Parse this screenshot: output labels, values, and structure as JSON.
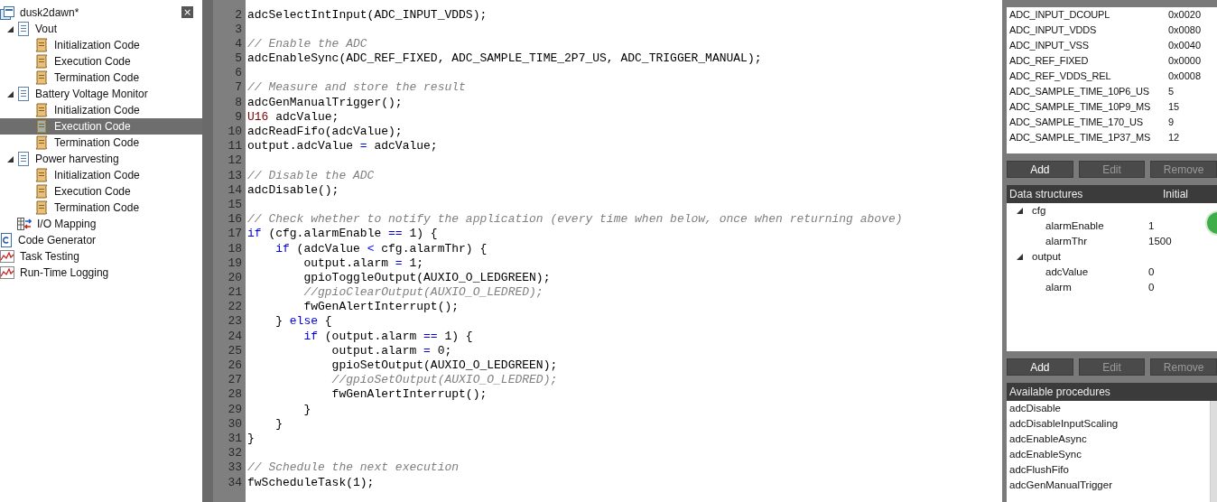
{
  "sidebar": {
    "close_label": "×",
    "items": [
      {
        "label": "dusk2dawn*",
        "kind": "project",
        "children": [
          {
            "label": "Vout",
            "kind": "task",
            "expanded": true,
            "children": [
              {
                "label": "Initialization Code",
                "kind": "code",
                "selected": false
              },
              {
                "label": "Execution Code",
                "kind": "code",
                "selected": false
              },
              {
                "label": "Termination Code",
                "kind": "code",
                "selected": false
              }
            ]
          },
          {
            "label": "Battery Voltage Monitor",
            "kind": "task",
            "expanded": true,
            "children": [
              {
                "label": "Initialization Code",
                "kind": "code",
                "selected": false
              },
              {
                "label": "Execution Code",
                "kind": "code",
                "selected": true
              },
              {
                "label": "Termination Code",
                "kind": "code",
                "selected": false
              }
            ]
          },
          {
            "label": "Power harvesting",
            "kind": "task",
            "expanded": true,
            "children": [
              {
                "label": "Initialization Code",
                "kind": "code",
                "selected": false
              },
              {
                "label": "Execution Code",
                "kind": "code",
                "selected": false
              },
              {
                "label": "Termination Code",
                "kind": "code",
                "selected": false
              }
            ]
          },
          {
            "label": "I/O Mapping",
            "kind": "io"
          }
        ]
      },
      {
        "label": "Code Generator",
        "kind": "codegen"
      },
      {
        "label": "Task Testing",
        "kind": "chart"
      },
      {
        "label": "Run-Time Logging",
        "kind": "chart"
      }
    ]
  },
  "editor": {
    "lines": [
      {
        "num": "2",
        "tokens": [
          {
            "kind": "plain",
            "text": "adcSelectIntInput(ADC_INPUT_VDDS);"
          }
        ]
      },
      {
        "num": "3"
      },
      {
        "num": "4",
        "tokens": [
          {
            "kind": "comment",
            "text": "// Enable the ADC"
          }
        ]
      },
      {
        "num": "5",
        "tokens": [
          {
            "kind": "plain",
            "text": "adcEnableSync(ADC_REF_FIXED, ADC_SAMPLE_TIME_2P7_US, ADC_TRIGGER_MANUAL);"
          }
        ]
      },
      {
        "num": "6"
      },
      {
        "num": "7",
        "tokens": [
          {
            "kind": "comment",
            "text": "// Measure and store the result"
          }
        ]
      },
      {
        "num": "8",
        "tokens": [
          {
            "kind": "plain",
            "text": "adcGenManualTrigger();"
          }
        ]
      },
      {
        "num": "9",
        "tokens": [
          {
            "kind": "type",
            "text": "U16"
          },
          {
            "kind": "plain",
            "text": " adcValue;"
          }
        ]
      },
      {
        "num": "10",
        "tokens": [
          {
            "kind": "plain",
            "text": "adcReadFifo(adcValue);"
          }
        ]
      },
      {
        "num": "11",
        "tokens": [
          {
            "kind": "plain",
            "text": "output.adcValue "
          },
          {
            "kind": "op",
            "text": "="
          },
          {
            "kind": "plain",
            "text": " adcValue;"
          }
        ]
      },
      {
        "num": "12"
      },
      {
        "num": "13",
        "tokens": [
          {
            "kind": "comment",
            "text": "// Disable the ADC"
          }
        ]
      },
      {
        "num": "14",
        "tokens": [
          {
            "kind": "plain",
            "text": "adcDisable();"
          }
        ]
      },
      {
        "num": "15"
      },
      {
        "num": "16",
        "tokens": [
          {
            "kind": "comment",
            "text": "// Check whether to notify the application (every time when below, once when returning above)"
          }
        ]
      },
      {
        "num": "17",
        "tokens": [
          {
            "kind": "keyword",
            "text": "if"
          },
          {
            "kind": "plain",
            "text": " (cfg.alarmEnable "
          },
          {
            "kind": "op",
            "text": "=="
          },
          {
            "kind": "plain",
            "text": " 1) {"
          }
        ]
      },
      {
        "num": "18",
        "tokens": [
          {
            "kind": "keyword",
            "text": "    if"
          },
          {
            "kind": "plain",
            "text": " (adcValue "
          },
          {
            "kind": "op",
            "text": "<"
          },
          {
            "kind": "plain",
            "text": " cfg.alarmThr) {"
          }
        ]
      },
      {
        "num": "19",
        "tokens": [
          {
            "kind": "plain",
            "text": "        output.alarm "
          },
          {
            "kind": "op",
            "text": "="
          },
          {
            "kind": "plain",
            "text": " 1;"
          }
        ]
      },
      {
        "num": "20",
        "tokens": [
          {
            "kind": "plain",
            "text": "        gpioToggleOutput(AUXIO_O_LEDGREEN);"
          }
        ]
      },
      {
        "num": "21",
        "tokens": [
          {
            "kind": "comment",
            "text": "        //gpioClearOutput(AUXIO_O_LEDRED);"
          }
        ]
      },
      {
        "num": "22",
        "tokens": [
          {
            "kind": "plain",
            "text": "        fwGenAlertInterrupt();"
          }
        ]
      },
      {
        "num": "23",
        "tokens": [
          {
            "kind": "plain",
            "text": "    } "
          },
          {
            "kind": "keyword",
            "text": "else"
          },
          {
            "kind": "plain",
            "text": " {"
          }
        ]
      },
      {
        "num": "24",
        "tokens": [
          {
            "kind": "keyword",
            "text": "        if"
          },
          {
            "kind": "plain",
            "text": " (output.alarm "
          },
          {
            "kind": "op",
            "text": "=="
          },
          {
            "kind": "plain",
            "text": " 1) {"
          }
        ]
      },
      {
        "num": "25",
        "tokens": [
          {
            "kind": "plain",
            "text": "            output.alarm "
          },
          {
            "kind": "op",
            "text": "="
          },
          {
            "kind": "plain",
            "text": " 0;"
          }
        ]
      },
      {
        "num": "26",
        "tokens": [
          {
            "kind": "plain",
            "text": "            gpioSetOutput(AUXIO_O_LEDGREEN);"
          }
        ]
      },
      {
        "num": "27",
        "tokens": [
          {
            "kind": "comment",
            "text": "            //gpioSetOutput(AUXIO_O_LEDRED);"
          }
        ]
      },
      {
        "num": "28",
        "tokens": [
          {
            "kind": "plain",
            "text": "            fwGenAlertInterrupt();"
          }
        ]
      },
      {
        "num": "29",
        "tokens": [
          {
            "kind": "plain",
            "text": "        }"
          }
        ]
      },
      {
        "num": "30",
        "tokens": [
          {
            "kind": "plain",
            "text": "    }"
          }
        ]
      },
      {
        "num": "31",
        "tokens": [
          {
            "kind": "plain",
            "text": "}"
          }
        ]
      },
      {
        "num": "32"
      },
      {
        "num": "33",
        "tokens": [
          {
            "kind": "comment",
            "text": "// Schedule the next execution"
          }
        ]
      },
      {
        "num": "34",
        "tokens": [
          {
            "kind": "plain",
            "text": "fwScheduleTask(1);"
          }
        ]
      }
    ]
  },
  "constants": {
    "rows": [
      {
        "name": "ADC_INPUT_DCOUPL",
        "value": "0x0020"
      },
      {
        "name": "ADC_INPUT_VDDS",
        "value": "0x0080"
      },
      {
        "name": "ADC_INPUT_VSS",
        "value": "0x0040"
      },
      {
        "name": "ADC_REF_FIXED",
        "value": "0x0000"
      },
      {
        "name": "ADC_REF_VDDS_REL",
        "value": "0x0008"
      },
      {
        "name": "ADC_SAMPLE_TIME_10P6_US",
        "value": "5"
      },
      {
        "name": "ADC_SAMPLE_TIME_10P9_MS",
        "value": "15"
      },
      {
        "name": "ADC_SAMPLE_TIME_170_US",
        "value": "9"
      },
      {
        "name": "ADC_SAMPLE_TIME_1P37_MS",
        "value": "12"
      }
    ],
    "buttons": [
      {
        "label": "Add",
        "disabled": false
      },
      {
        "label": "Edit",
        "disabled": true
      },
      {
        "label": "Remove",
        "disabled": true
      }
    ]
  },
  "data_structures": {
    "title": "Data structures",
    "column": "Initial",
    "items": [
      {
        "name": "cfg",
        "expanded": true,
        "children": [
          {
            "name": "alarmEnable",
            "value": "1"
          },
          {
            "name": "alarmThr",
            "value": "1500"
          }
        ]
      },
      {
        "name": "output",
        "expanded": true,
        "children": [
          {
            "name": "adcValue",
            "value": "0"
          },
          {
            "name": "alarm",
            "value": "0"
          }
        ]
      }
    ],
    "buttons": [
      {
        "label": "Add",
        "disabled": false
      },
      {
        "label": "Edit",
        "disabled": true
      },
      {
        "label": "Remove",
        "disabled": true
      }
    ]
  },
  "procedures": {
    "title": "Available procedures",
    "items": [
      "adcDisable",
      "adcDisableInputScaling",
      "adcEnableAsync",
      "adcEnableSync",
      "adcFlushFifo",
      "adcGenManualTrigger"
    ]
  }
}
